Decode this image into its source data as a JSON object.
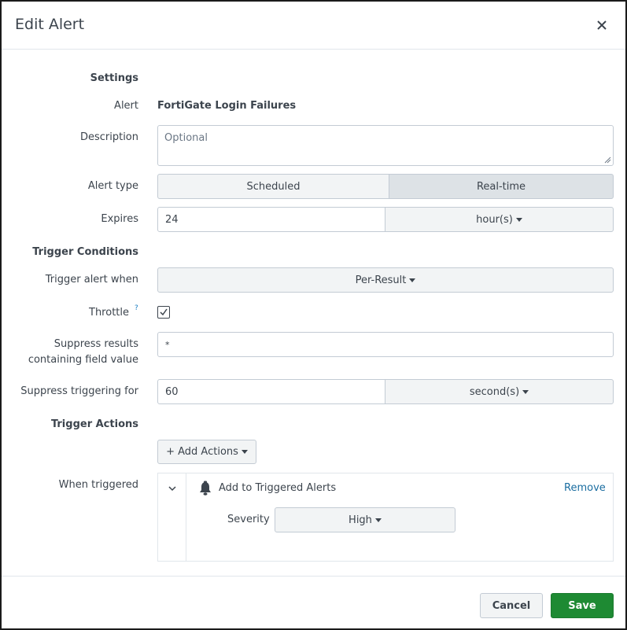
{
  "modal": {
    "title": "Edit Alert"
  },
  "settings": {
    "section_label": "Settings",
    "alert_label": "Alert",
    "alert_name": "FortiGate Login Failures",
    "description_label": "Description",
    "description_placeholder": "Optional",
    "description_value": "",
    "alert_type_label": "Alert type",
    "alert_type_options": [
      "Scheduled",
      "Real-time"
    ],
    "alert_type_selected": "Real-time",
    "expires_label": "Expires",
    "expires_value": "24",
    "expires_unit": "hour(s)"
  },
  "trigger_conditions": {
    "section_label": "Trigger Conditions",
    "trigger_when_label": "Trigger alert when",
    "trigger_when_value": "Per-Result",
    "throttle_label": "Throttle",
    "throttle_help": "?",
    "throttle_checked": true,
    "suppress_fields_label_line1": "Suppress results",
    "suppress_fields_label_line2": "containing field value",
    "suppress_fields_value": "*",
    "suppress_period_label": "Suppress triggering for",
    "suppress_period_value": "60",
    "suppress_period_unit": "second(s)"
  },
  "trigger_actions": {
    "section_label": "Trigger Actions",
    "add_actions_label": "+ Add Actions",
    "when_triggered_label": "When triggered",
    "actions": [
      {
        "title": "Add to Triggered Alerts",
        "icon": "bell-icon",
        "remove_label": "Remove",
        "severity_label": "Severity",
        "severity_value": "High"
      }
    ]
  },
  "footer": {
    "cancel_label": "Cancel",
    "save_label": "Save"
  },
  "colors": {
    "primary_green": "#1e8a33",
    "link_blue": "#1a6da0",
    "border": "#c3cbd4",
    "text": "#3c444d"
  }
}
